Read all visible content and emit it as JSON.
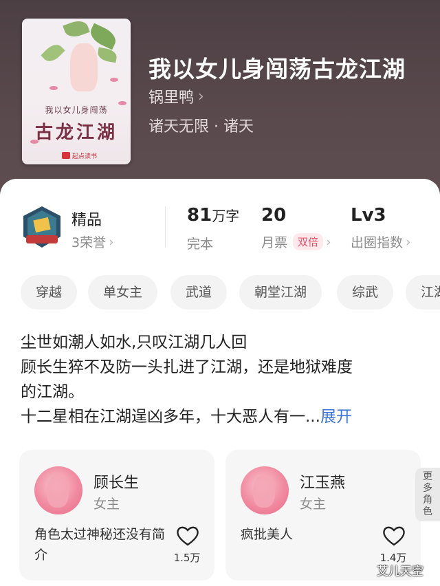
{
  "book": {
    "title": "我以女儿身闯荡古龙江湖",
    "author": "锅里鸭",
    "author_chevron": "›",
    "genre": "诸天无限 · 诸天",
    "cover": {
      "subtitle": "我以女儿身闯荡",
      "title": "古龙江湖",
      "publisher": "起点读书"
    }
  },
  "stats": {
    "quality": {
      "label": "精品",
      "honor": "3荣誉",
      "chevron": "›"
    },
    "words": {
      "number": "81",
      "unit": "万字",
      "status": "完本"
    },
    "monthly_ticket": {
      "number": "20",
      "label": "月票",
      "badge": "双倍",
      "chevron": "›"
    },
    "level": {
      "value": "Lv3",
      "label": "出圈指数",
      "chevron": "›"
    }
  },
  "tags": [
    "穿越",
    "单女主",
    "武道",
    "朝堂江湖",
    "综武",
    "江湖"
  ],
  "synopsis": {
    "lines": [
      "尘世如潮人如水,只叹江湖几人回",
      "顾长生猝不及防一头扎进了江湖，还是地狱难度",
      "的江湖。",
      "十二星相在江湖逞凶多年，十大恶人有一..."
    ],
    "expand": "展开"
  },
  "roles": [
    {
      "name": "顾长生",
      "type": "女主",
      "desc": "角色太过神秘还没有简介",
      "likes": "1.5万"
    },
    {
      "name": "江玉燕",
      "type": "女主",
      "desc": "疯批美人",
      "likes": "1.4万"
    }
  ],
  "more_roles": "更多角色",
  "watermark": "艾儿天空",
  "colors": {
    "hero_bg": "#4c3f43",
    "accent_link": "#3d74d9",
    "badge_pink": "#e8536a"
  }
}
